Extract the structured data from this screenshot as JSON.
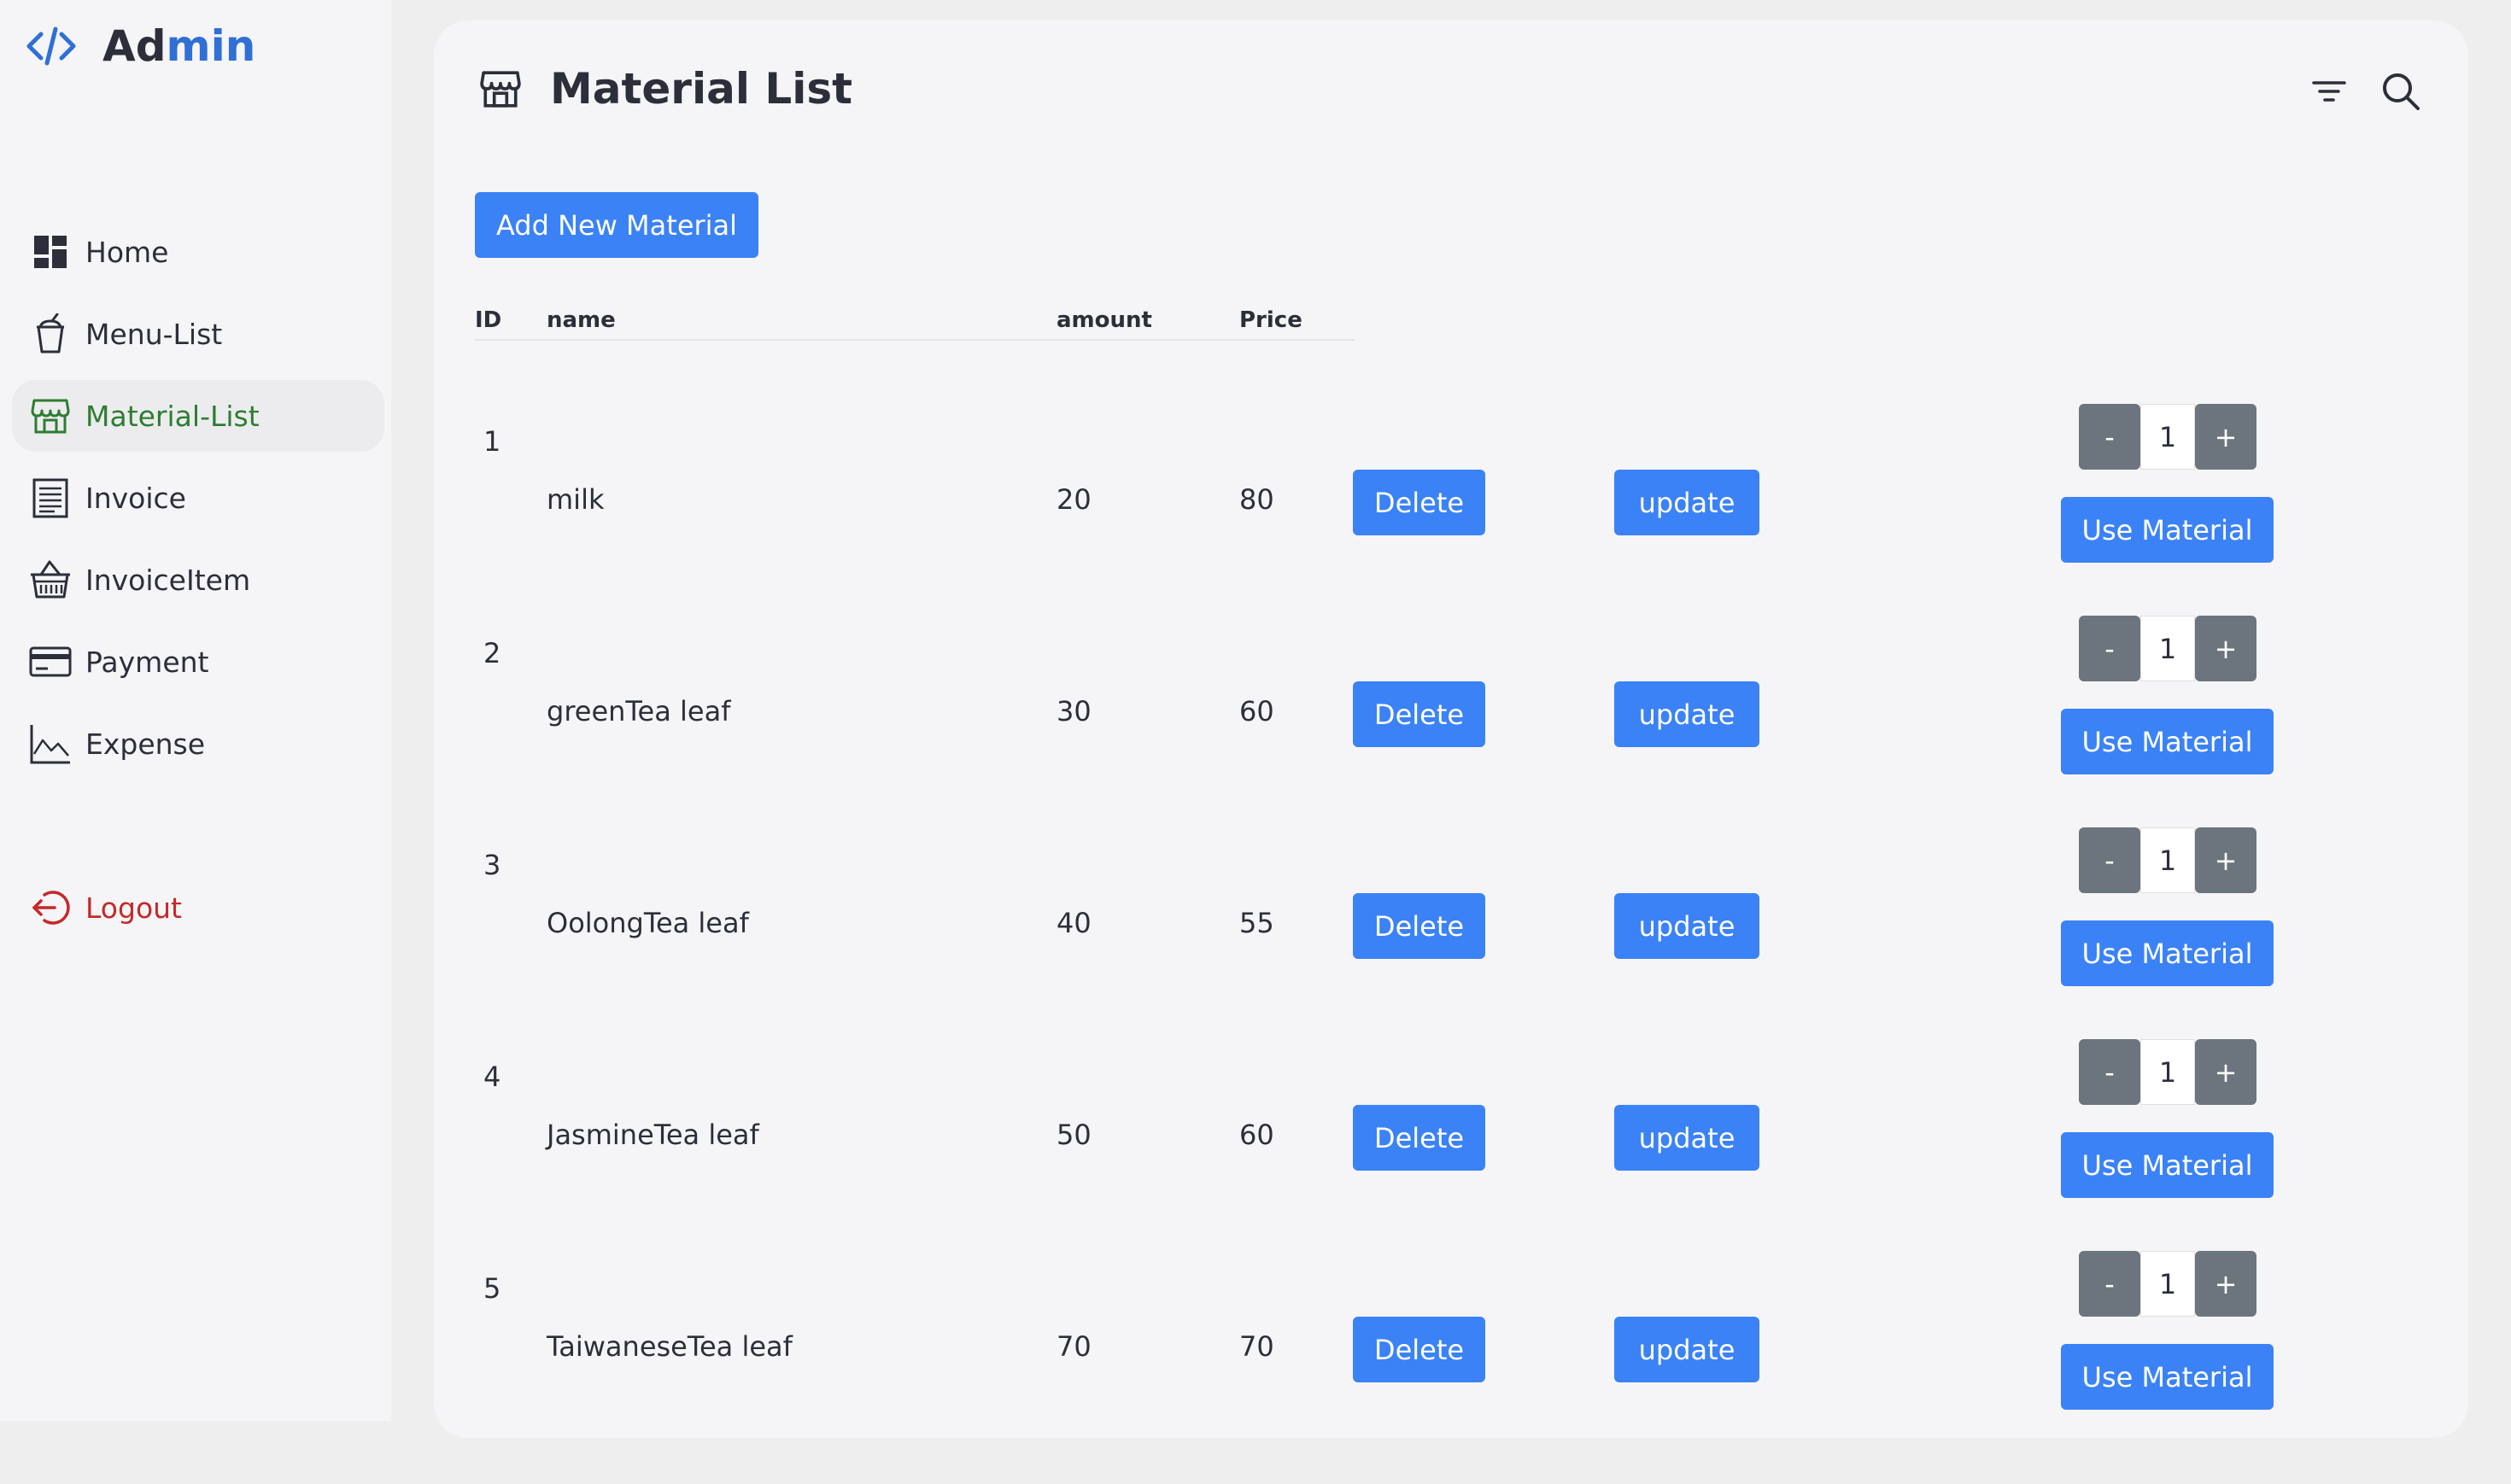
{
  "app": {
    "logo_prefix": "Ad",
    "logo_suffix": "min"
  },
  "sidebar": {
    "items": [
      {
        "label": "Home",
        "icon": "dashboard-icon"
      },
      {
        "label": "Menu-List",
        "icon": "cup-icon"
      },
      {
        "label": "Material-List",
        "icon": "store-icon",
        "active": true
      },
      {
        "label": "Invoice",
        "icon": "receipt-icon"
      },
      {
        "label": "InvoiceItem",
        "icon": "basket-icon"
      },
      {
        "label": "Payment",
        "icon": "credit-card-icon"
      },
      {
        "label": "Expense",
        "icon": "line-chart-icon"
      }
    ],
    "logout_label": "Logout"
  },
  "header": {
    "title": "Material List",
    "icon": "store-icon",
    "tools": [
      "filter-icon",
      "search-icon"
    ]
  },
  "toolbar": {
    "add_label": "Add New Material"
  },
  "table": {
    "columns": [
      "ID",
      "name",
      "amount",
      "Price"
    ],
    "delete_label": "Delete",
    "update_label": "update",
    "use_label": "Use Material",
    "minus_label": "-",
    "plus_label": "+",
    "rows": [
      {
        "id": "1",
        "name": "milk",
        "amount": "20",
        "price": "80",
        "qty": "1"
      },
      {
        "id": "2",
        "name": "greenTea leaf",
        "amount": "30",
        "price": "60",
        "qty": "1"
      },
      {
        "id": "3",
        "name": "OolongTea leaf",
        "amount": "40",
        "price": "55",
        "qty": "1"
      },
      {
        "id": "4",
        "name": "JasmineTea leaf",
        "amount": "50",
        "price": "60",
        "qty": "1"
      },
      {
        "id": "5",
        "name": "TaiwaneseTea leaf",
        "amount": "70",
        "price": "70",
        "qty": "1"
      }
    ]
  },
  "colors": {
    "primary": "#3b82f6",
    "active_nav": "#2e7d32",
    "logout": "#c62828",
    "stepper": "#6c757d",
    "logo_accent": "#2f6fd6"
  }
}
